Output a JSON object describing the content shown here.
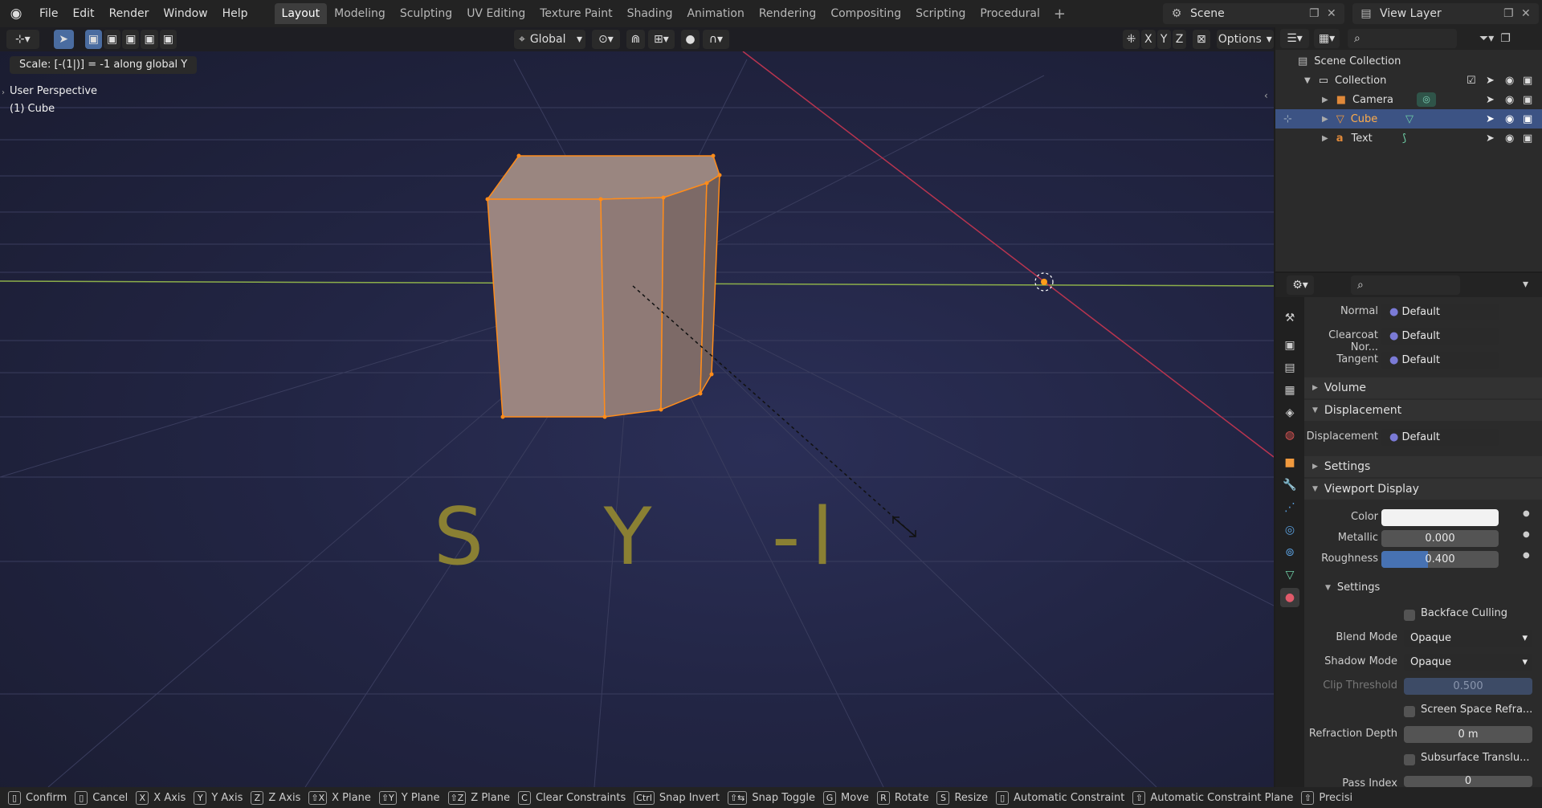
{
  "menu": [
    "File",
    "Edit",
    "Render",
    "Window",
    "Help"
  ],
  "workspaces": [
    "Layout",
    "Modeling",
    "Sculpting",
    "UV Editing",
    "Texture Paint",
    "Shading",
    "Animation",
    "Rendering",
    "Compositing",
    "Scripting",
    "Procedural"
  ],
  "active_workspace": "Layout",
  "scene": "Scene",
  "view_layer": "View Layer",
  "viewport": {
    "orientation": "Global",
    "options": "Options",
    "axes": [
      "X",
      "Y",
      "Z"
    ],
    "operator_msg": "Scale: [-(1|)] = -1  along global Y",
    "perspective": "User Perspective",
    "object": "(1) Cube",
    "text_object": "S   Y   -l"
  },
  "outliner": {
    "root": "Scene Collection",
    "collection": "Collection",
    "items": [
      {
        "name": "Camera",
        "icon": "camera-icon",
        "selected": false
      },
      {
        "name": "Cube",
        "icon": "mesh-icon",
        "selected": true
      },
      {
        "name": "Text",
        "icon": "text-icon",
        "selected": false
      }
    ]
  },
  "properties": {
    "normal_label": "Normal",
    "normal_value": "Default",
    "clearcoat_label": "Clearcoat Nor...",
    "clearcoat_value": "Default",
    "tangent_label": "Tangent",
    "tangent_value": "Default",
    "volume": "Volume",
    "displacement_panel": "Displacement",
    "displacement_label": "Displacement",
    "displacement_value": "Default",
    "settings_panel": "Settings",
    "viewport_display": "Viewport Display",
    "color_label": "Color",
    "metallic_label": "Metallic",
    "metallic_value": "0.000",
    "roughness_label": "Roughness",
    "roughness_value": "0.400",
    "roughness_fraction": 0.4,
    "settings_sub": "Settings",
    "backface": "Backface Culling",
    "blend_label": "Blend Mode",
    "blend_value": "Opaque",
    "shadow_label": "Shadow Mode",
    "shadow_value": "Opaque",
    "clip_label": "Clip Threshold",
    "clip_value": "0.500",
    "ssr": "Screen Space Refra...",
    "refr_label": "Refraction Depth",
    "refr_value": "0 m",
    "sss": "Subsurface Translu...",
    "pass_label": "Pass Index",
    "pass_value": "0"
  },
  "status": [
    {
      "key": "",
      "label": "Confirm"
    },
    {
      "key": "",
      "label": "Cancel"
    },
    {
      "key": "X",
      "label": "X Axis"
    },
    {
      "key": "Y",
      "label": "Y Axis"
    },
    {
      "key": "Z",
      "label": "Z Axis"
    },
    {
      "key": "⇧X",
      "label": "X Plane"
    },
    {
      "key": "⇧Y",
      "label": "Y Plane"
    },
    {
      "key": "⇧Z",
      "label": "Z Plane"
    },
    {
      "key": "C",
      "label": "Clear Constraints"
    },
    {
      "key": "Ctrl",
      "label": "Snap Invert"
    },
    {
      "key": "⇧⇆",
      "label": "Snap Toggle"
    },
    {
      "key": "G",
      "label": "Move"
    },
    {
      "key": "R",
      "label": "Rotate"
    },
    {
      "key": "S",
      "label": "Resize"
    },
    {
      "key": "",
      "label": "Automatic Constraint"
    },
    {
      "key": "⇧",
      "label": "Automatic Constraint Plane"
    },
    {
      "key": "⇧",
      "label": "Precisi"
    }
  ],
  "colors": {
    "accent": "#4a6ca0",
    "selected_row": "#3c5384",
    "edge": "#ff8c1a"
  }
}
